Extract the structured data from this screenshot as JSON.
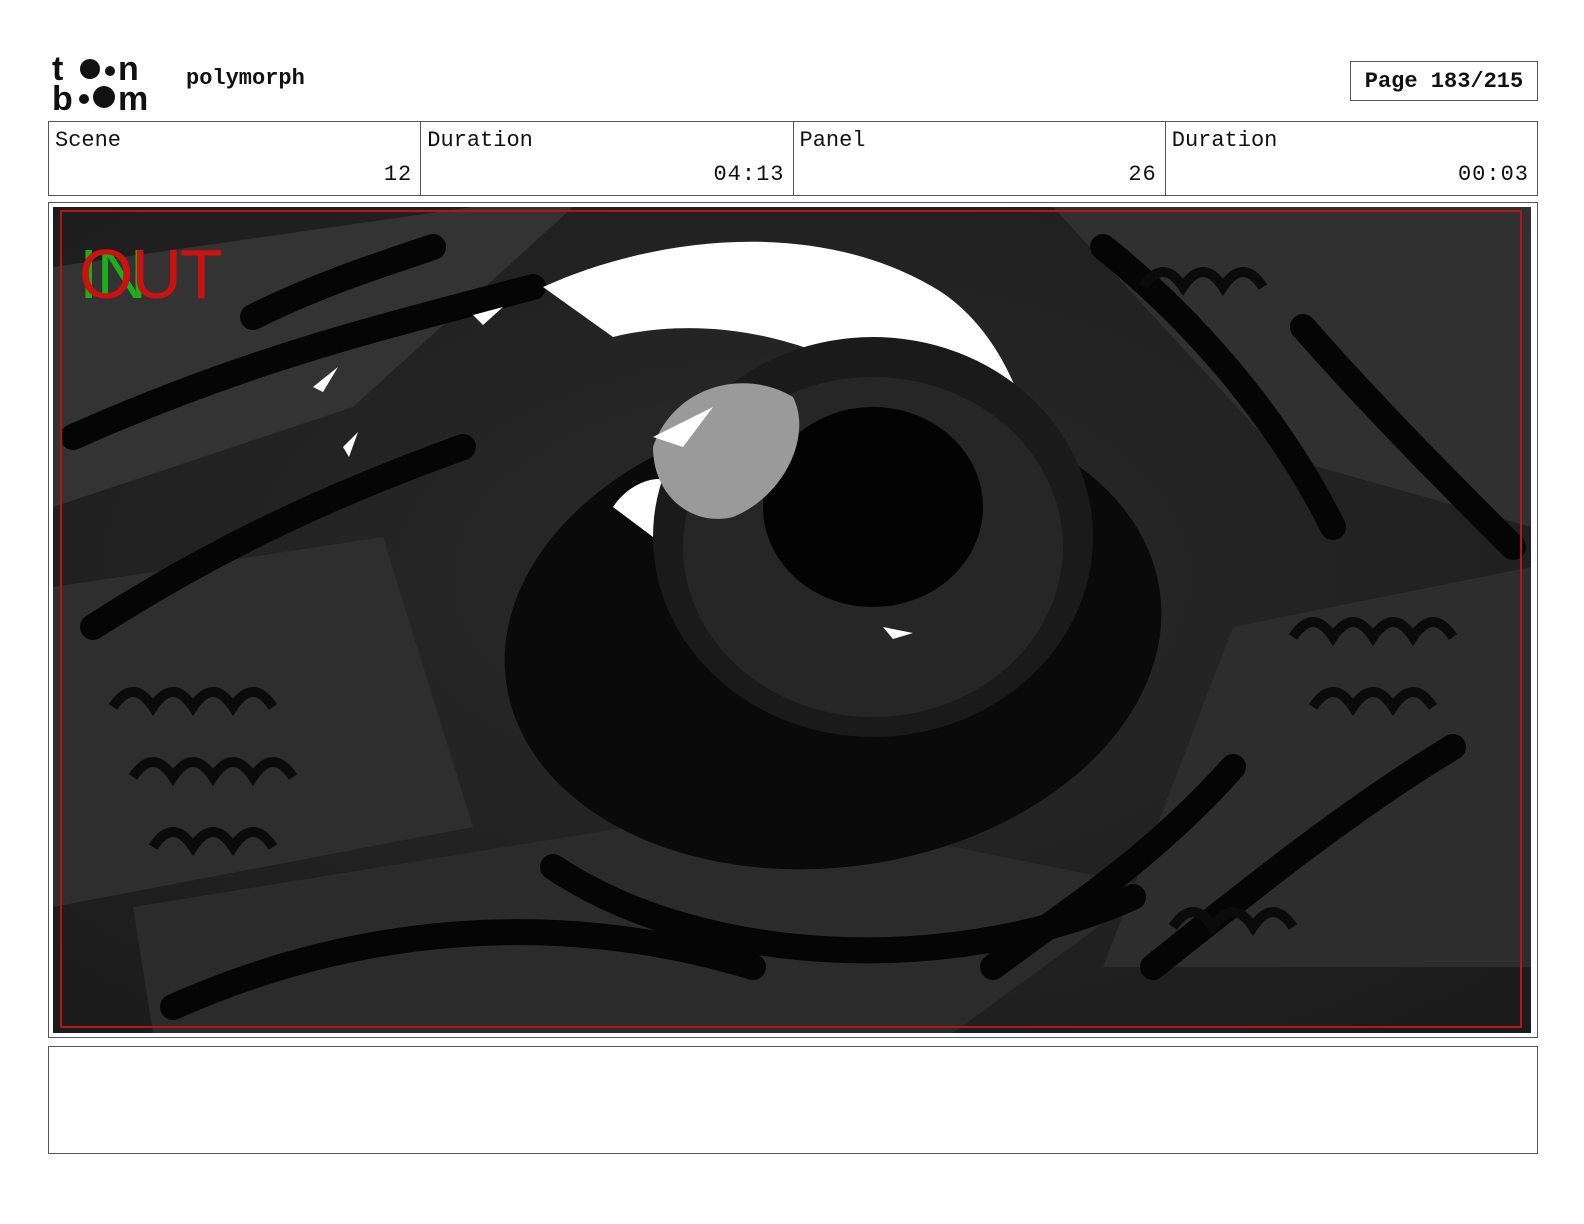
{
  "header": {
    "logo_text_top": "toon",
    "logo_text_bottom": "boom",
    "project_title": "polymorph",
    "page_label": "Page 183/215"
  },
  "info": {
    "scene_label": "Scene",
    "scene_value": "12",
    "scene_duration_label": "Duration",
    "scene_duration_value": "04:13",
    "panel_label": "Panel",
    "panel_value": "26",
    "panel_duration_label": "Duration",
    "panel_duration_value": "00:03"
  },
  "panel": {
    "in_marker": "IN",
    "out_marker": "OUT",
    "in_color": "#19b019",
    "out_color": "#cc1111",
    "safe_frame_color": "#b01818"
  },
  "notes": {
    "text": ""
  }
}
